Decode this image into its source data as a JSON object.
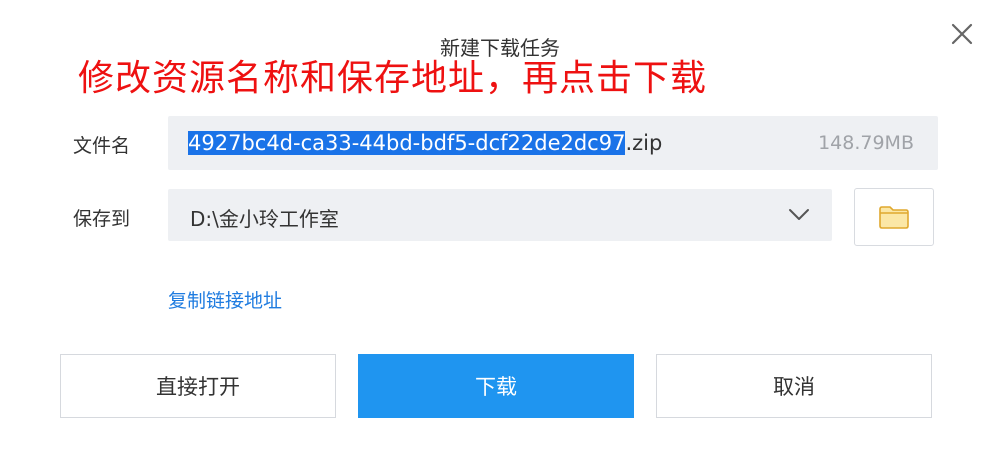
{
  "dialog": {
    "title": "新建下载任务"
  },
  "annotation": {
    "text": "修改资源名称和保存地址，再点击下载",
    "color": "#ee1111"
  },
  "filename": {
    "label": "文件名",
    "selected_part": "4927bc4d-ca33-44bd-bdf5-dcf22de2dc97",
    "extension": ".zip",
    "size": "148.79MB"
  },
  "saveto": {
    "label": "保存到",
    "path": "D:\\金小玲工作室"
  },
  "links": {
    "copy_link": "复制链接地址"
  },
  "buttons": {
    "open_directly": "直接打开",
    "download": "下载",
    "cancel": "取消"
  },
  "icons": {
    "close": "close-icon",
    "dropdown": "chevron-down-icon",
    "folder": "folder-icon"
  },
  "colors": {
    "accent": "#1f95f0",
    "selection": "#1a73e8",
    "link": "#1f7ce0",
    "folder_icon": "#e9b949"
  }
}
